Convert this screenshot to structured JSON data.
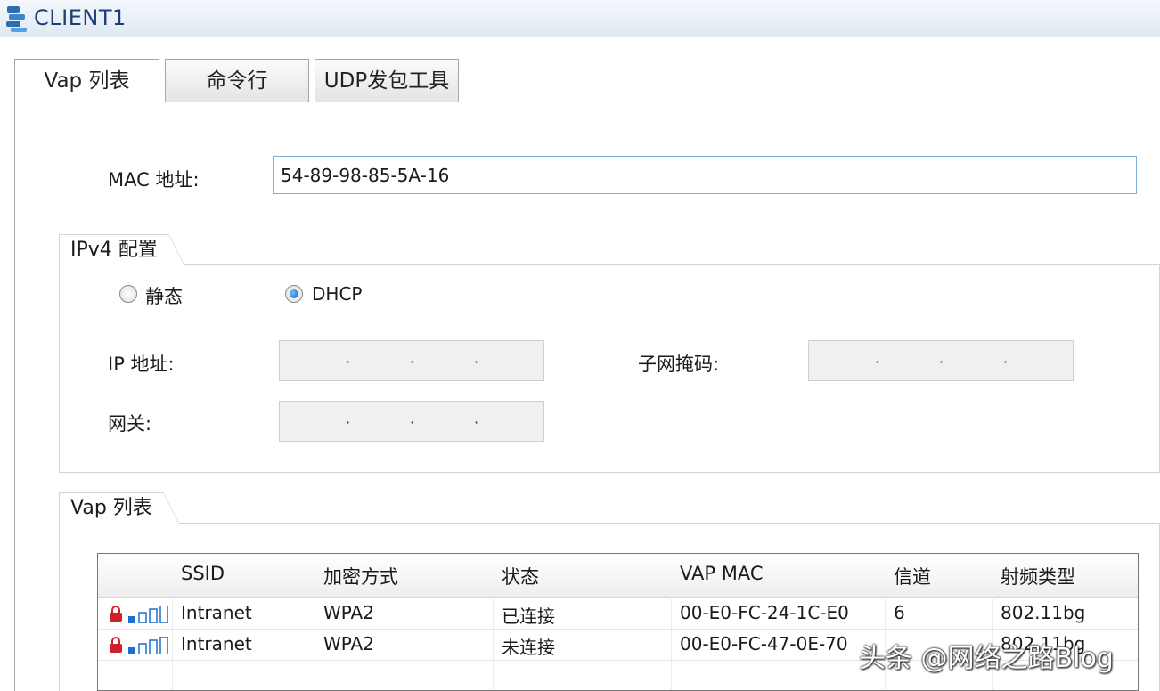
{
  "window": {
    "title": "CLIENT1"
  },
  "tabs": [
    {
      "label": "Vap 列表",
      "active": true
    },
    {
      "label": "命令行",
      "active": false
    },
    {
      "label": "UDP发包工具",
      "active": false
    }
  ],
  "mac": {
    "label": "MAC 地址:",
    "value": "54-89-98-85-5A-16"
  },
  "ipv4": {
    "title": "IPv4 配置",
    "static_label": "静态",
    "dhcp_label": "DHCP",
    "selected": "DHCP",
    "ip_label": "IP 地址:",
    "mask_label": "子网掩码:",
    "gateway_label": "网关:"
  },
  "vap": {
    "title": "Vap 列表",
    "columns": [
      "SSID",
      "加密方式",
      "状态",
      "VAP MAC",
      "信道",
      "射频类型"
    ],
    "rows": [
      {
        "ssid": "Intranet",
        "encryption": "WPA2",
        "status": "已连接",
        "vap_mac": "00-E0-FC-24-1C-E0",
        "channel": "6",
        "radio": "802.11bg"
      },
      {
        "ssid": "Intranet",
        "encryption": "WPA2",
        "status": "未连接",
        "vap_mac": "00-E0-FC-47-0E-70",
        "channel": "",
        "radio": "802.11bg"
      }
    ]
  },
  "watermark": "头条 @网络之路Blog",
  "colors": {
    "title": "#1b3f7a",
    "lock": "#d0202a",
    "signal": "#1a6fd0",
    "input_border": "#7fb0d8"
  },
  "icons": [
    "app-icon",
    "lock-icon",
    "signal-icon",
    "radio-button"
  ]
}
